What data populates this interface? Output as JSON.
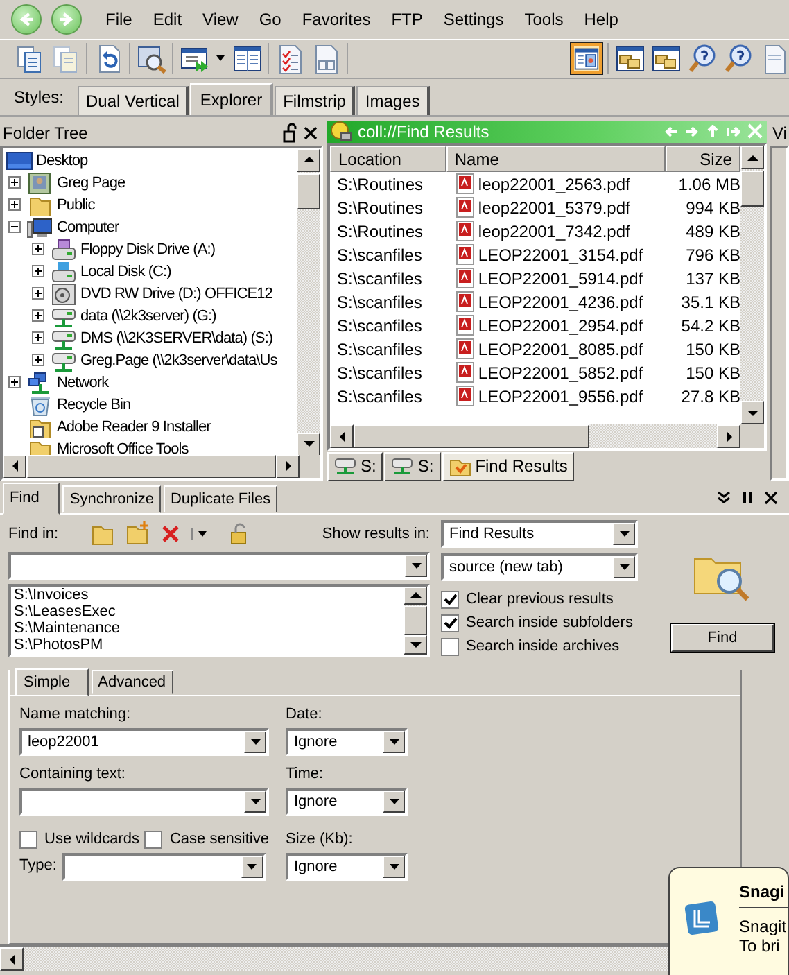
{
  "menu": [
    "File",
    "Edit",
    "View",
    "Go",
    "Favorites",
    "FTP",
    "Settings",
    "Tools",
    "Help"
  ],
  "toolbar": [
    [
      {
        "kind": "pages",
        "selected": false
      },
      {
        "kind": "pages-faded",
        "selected": false
      }
    ],
    [
      {
        "kind": "undo",
        "selected": false
      }
    ],
    [
      {
        "kind": "preview",
        "selected": false
      }
    ],
    [
      {
        "kind": "run",
        "selected": false
      },
      {
        "kind": "columns",
        "selected": false
      }
    ],
    [
      {
        "kind": "checklist",
        "selected": false
      },
      {
        "kind": "grid",
        "selected": false
      }
    ],
    [
      {
        "kind": "pane",
        "selected": true
      }
    ],
    [
      {
        "kind": "folders",
        "selected": false
      },
      {
        "kind": "folders",
        "selected": false
      },
      {
        "kind": "help",
        "selected": false
      },
      {
        "kind": "help",
        "selected": false
      },
      {
        "kind": "page",
        "selected": false
      }
    ]
  ],
  "styles": {
    "label": "Styles:",
    "tabs": [
      {
        "label": "Dual Vertical",
        "selected": false
      },
      {
        "label": "Explorer",
        "selected": true
      },
      {
        "label": "Filmstrip",
        "selected": false
      },
      {
        "label": "Images",
        "selected": false
      }
    ]
  },
  "folder_tree": {
    "title": "Folder Tree",
    "items": [
      {
        "label": "Desktop",
        "kind": "desktop",
        "children": [
          {
            "label": "Greg Page",
            "kind": "user",
            "expanded": false
          },
          {
            "label": "Public",
            "kind": "folder",
            "expanded": false
          },
          {
            "label": "Computer",
            "kind": "computer",
            "expanded": true,
            "children": [
              {
                "label": "Floppy Disk Drive (A:)",
                "kind": "floppy",
                "expanded": false
              },
              {
                "label": "Local Disk (C:)",
                "kind": "disk",
                "expanded": false
              },
              {
                "label": "DVD RW Drive (D:) OFFICE12",
                "kind": "dvd",
                "expanded": false
              },
              {
                "label": "data (\\\\2k3server) (G:)",
                "kind": "netdrive",
                "expanded": false
              },
              {
                "label": "DMS (\\\\2K3SERVER\\data) (S:)",
                "kind": "netdrive",
                "expanded": false
              },
              {
                "label": "Greg.Page (\\\\2k3server\\data\\Us",
                "kind": "netdrive",
                "expanded": false
              }
            ]
          },
          {
            "label": "Network",
            "kind": "network",
            "expanded": false
          },
          {
            "label": "Recycle Bin",
            "kind": "recycle"
          },
          {
            "label": "Adobe Reader 9 Installer",
            "kind": "installer"
          },
          {
            "label": "Microsoft Office Tools",
            "kind": "folder"
          }
        ]
      }
    ]
  },
  "file_pane": {
    "address": "coll://Find Results",
    "columns": [
      "Location",
      "Name",
      "Size"
    ],
    "rows": [
      {
        "location": "S:\\Routines",
        "name": "leop22001_2563.pdf",
        "size": "1.06 MB"
      },
      {
        "location": "S:\\Routines",
        "name": "leop22001_5379.pdf",
        "size": "994 KB"
      },
      {
        "location": "S:\\Routines",
        "name": "leop22001_7342.pdf",
        "size": "489 KB"
      },
      {
        "location": "S:\\scanfiles",
        "name": "LEOP22001_3154.pdf",
        "size": "796 KB"
      },
      {
        "location": "S:\\scanfiles",
        "name": "LEOP22001_5914.pdf",
        "size": "137 KB"
      },
      {
        "location": "S:\\scanfiles",
        "name": "LEOP22001_4236.pdf",
        "size": "35.1 KB"
      },
      {
        "location": "S:\\scanfiles",
        "name": "LEOP22001_2954.pdf",
        "size": "54.2 KB"
      },
      {
        "location": "S:\\scanfiles",
        "name": "LEOP22001_8085.pdf",
        "size": "150 KB"
      },
      {
        "location": "S:\\scanfiles",
        "name": "LEOP22001_5852.pdf",
        "size": "150 KB"
      },
      {
        "location": "S:\\scanfiles",
        "name": "LEOP22001_9556.pdf",
        "size": "27.8 KB"
      }
    ],
    "tabs": [
      {
        "label": "S:",
        "kind": "drive",
        "selected": false
      },
      {
        "label": "S:",
        "kind": "drive",
        "selected": false
      },
      {
        "label": "Find Results",
        "kind": "find",
        "selected": true
      }
    ]
  },
  "right_pane": {
    "title": "Vi"
  },
  "find_panel": {
    "tabs": [
      {
        "label": "Find",
        "selected": true
      },
      {
        "label": "Synchronize",
        "selected": false
      },
      {
        "label": "Duplicate Files",
        "selected": false
      }
    ],
    "find_in_label": "Find in:",
    "locations": [
      "S:\\Invoices",
      "S:\\LeasesExec",
      "S:\\Maintenance",
      "S:\\PhotosPM"
    ],
    "show_results_label": "Show results in:",
    "show_results_in": "Find Results",
    "open_in": "source (new tab)",
    "options": [
      {
        "label": "Clear previous results",
        "checked": true
      },
      {
        "label": "Search inside subfolders",
        "checked": true
      },
      {
        "label": "Search inside archives",
        "checked": false
      }
    ],
    "find_button": "Find",
    "subtabs": [
      {
        "label": "Simple",
        "selected": true
      },
      {
        "label": "Advanced",
        "selected": false
      }
    ],
    "name_label": "Name matching:",
    "name_value": "leop22001",
    "text_label": "Containing text:",
    "flags": [
      {
        "label": "Use wildcards",
        "checked": false
      },
      {
        "label": "Case sensitive",
        "checked": false
      }
    ],
    "type_label": "Type:",
    "filters": [
      {
        "label": "Date:",
        "value": "Ignore"
      },
      {
        "label": "Time:",
        "value": "Ignore"
      },
      {
        "label": "Size (Kb):",
        "value": "Ignore"
      }
    ]
  },
  "toast": {
    "title": "Snagi",
    "lines": [
      "Snagit",
      "To bri"
    ]
  }
}
